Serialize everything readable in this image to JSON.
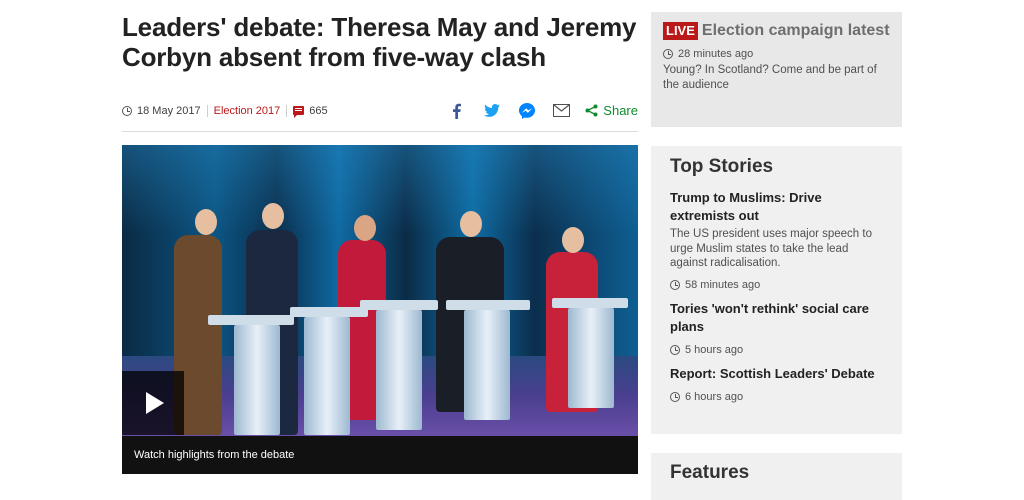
{
  "article": {
    "headline": "Leaders' debate: Theresa May and Jeremy Corbyn absent from five-way clash",
    "date": "18 May 2017",
    "section": "Election 2017",
    "comment_count": "665",
    "share_label": "Share",
    "media": {
      "caption": "Watch highlights from the debate"
    }
  },
  "live": {
    "badge": "LIVE",
    "title": "Election campaign latest",
    "time": "28 minutes ago",
    "text": "Young? In Scotland? Come and be part of the audience"
  },
  "top_stories": {
    "title": "Top Stories",
    "items": [
      {
        "headline": "Trump to Muslims: Drive extremists out",
        "summary": "The US president uses major speech to urge Muslim states to take the lead against radicalisation.",
        "time": "58 minutes ago"
      },
      {
        "headline": "Tories 'won't rethink' social care plans",
        "time": "5 hours ago"
      },
      {
        "headline": "Report: Scottish Leaders' Debate",
        "time": "6 hours ago"
      }
    ]
  },
  "features": {
    "title": "Features"
  },
  "colors": {
    "accent_red": "#bb1919",
    "share_green": "#0f8b2e",
    "facebook": "#3b5998",
    "twitter": "#1da1f2",
    "messenger": "#0084ff"
  },
  "icons": [
    "clock-icon",
    "comment-icon",
    "facebook-icon",
    "twitter-icon",
    "messenger-icon",
    "email-icon",
    "share-icon",
    "play-icon"
  ]
}
